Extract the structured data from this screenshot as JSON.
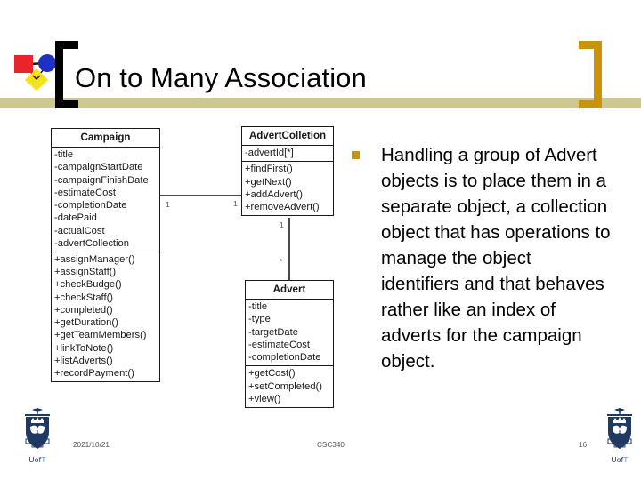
{
  "slide": {
    "title": "On to Many Association",
    "accent_gold": "#c8940b",
    "rule_khaki": "#cdc88f",
    "bracket_left_color": "#000000",
    "bracket_right_color": "#c8940b"
  },
  "logo": {
    "name": "powerpoint-design-logo",
    "square_color": "#e8252a",
    "circle_color": "#1f31c4",
    "diamond_color": "#f5e31a"
  },
  "diagram": {
    "classes": [
      {
        "name": "Campaign",
        "attributes": [
          "-title",
          "-campaignStartDate",
          "-campaignFinishDate",
          "-estimateCost",
          "-completionDate",
          "-datePaid",
          "-actualCost",
          "-advertCollection"
        ],
        "operations": [
          "+assignManager()",
          "+assignStaff()",
          "+checkBudge()",
          "+checkStaff()",
          "+completed()",
          "+getDuration()",
          "+getTeamMembers()",
          "+linkToNote()",
          "+listAdverts()",
          "+recordPayment()"
        ]
      },
      {
        "name": "AdvertColletion",
        "attributes": [
          "-advertId[*]"
        ],
        "operations": [
          "+findFirst()",
          "+getNext()",
          "+addAdvert()",
          "+removeAdvert()"
        ]
      },
      {
        "name": "Advert",
        "attributes": [
          "-title",
          "-type",
          "-targetDate",
          "-estimateCost",
          "-completionDate"
        ],
        "operations": [
          "+getCost()",
          "+setCompleted()",
          "+view()"
        ]
      }
    ],
    "multiplicities": {
      "campaign_end": "1",
      "collection_end": "1",
      "collection_down": "1",
      "advert_up": "*"
    }
  },
  "body": {
    "bullet_glyph": "square",
    "text": "Handling a group of Advert objects is to place them in a separate object, a collection object that has operations to manage the object identifiers and that behaves rather like an index of adverts for the campaign object."
  },
  "footer": {
    "date": "2021/10/21",
    "course": "CSC340",
    "page_number": "16",
    "logo_wordmark_prefix": "Uof",
    "logo_wordmark_suffix": "T"
  }
}
